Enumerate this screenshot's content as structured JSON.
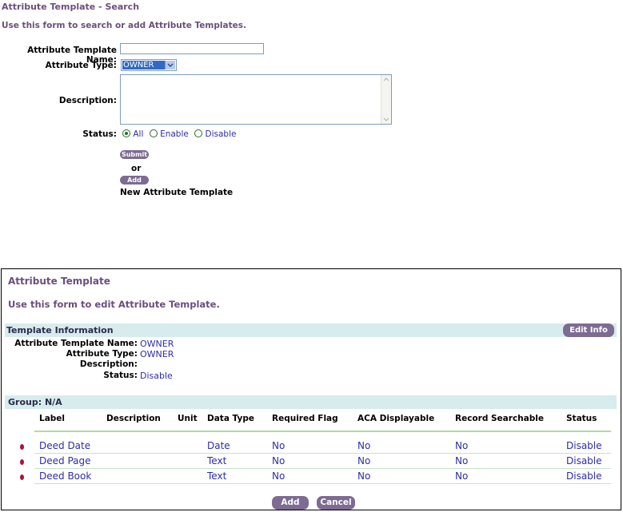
{
  "search": {
    "title": "Attribute Template - Search",
    "subtitle": "Use this form to search or add Attribute Templates.",
    "name_label": "Attribute Template Name:",
    "name_value": "",
    "type_label": "Attribute Type:",
    "type_value": "OWNER",
    "desc_label": "Description:",
    "desc_value": "",
    "status_label": "Status:",
    "status_options": [
      "All",
      "Enable",
      "Disable"
    ],
    "status_selected": "All",
    "submit_label": "Submit",
    "or_text": "or",
    "add_label": "Add",
    "new_text": "New Attribute Template"
  },
  "edit": {
    "title": "Attribute Template",
    "subtitle": "Use this form to edit Attribute Template.",
    "section_title": "Template Information",
    "edit_info_label": "Edit Info",
    "fields": [
      {
        "label": "Attribute Template Name:",
        "value": "OWNER"
      },
      {
        "label": "Attribute Type:",
        "value": "OWNER"
      },
      {
        "label": "Description:",
        "value": ""
      },
      {
        "label": "Status:",
        "value": "Disable"
      }
    ],
    "group_title": "Group: N/A",
    "columns": [
      "Label",
      "Description",
      "Unit",
      "Data Type",
      "Required Flag",
      "ACA Displayable",
      "Record Searchable",
      "Status"
    ],
    "rows": [
      {
        "label": "Deed Date",
        "description": "",
        "unit": "",
        "data_type": "Date",
        "required": "No",
        "aca": "No",
        "searchable": "No",
        "status": "Disable"
      },
      {
        "label": "Deed Page",
        "description": "",
        "unit": "",
        "data_type": "Text",
        "required": "No",
        "aca": "No",
        "searchable": "No",
        "status": "Disable"
      },
      {
        "label": "Deed Book",
        "description": "",
        "unit": "",
        "data_type": "Text",
        "required": "No",
        "aca": "No",
        "searchable": "No",
        "status": "Disable"
      }
    ],
    "add_label": "Add",
    "cancel_label": "Cancel"
  },
  "colors": {
    "accent": "#6a4f7e",
    "button": "#7d6b93",
    "link": "#2d2da8",
    "band": "#d7ecec",
    "bullet": "#b0103a"
  }
}
